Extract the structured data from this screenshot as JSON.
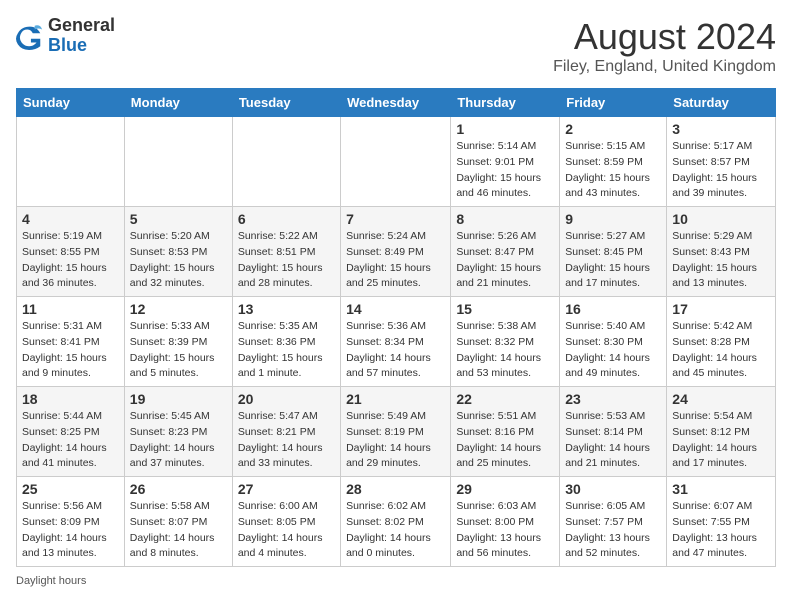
{
  "header": {
    "logo_general": "General",
    "logo_blue": "Blue",
    "month_title": "August 2024",
    "location": "Filey, England, United Kingdom"
  },
  "days_of_week": [
    "Sunday",
    "Monday",
    "Tuesday",
    "Wednesday",
    "Thursday",
    "Friday",
    "Saturday"
  ],
  "weeks": [
    [
      {
        "day": "",
        "info": ""
      },
      {
        "day": "",
        "info": ""
      },
      {
        "day": "",
        "info": ""
      },
      {
        "day": "",
        "info": ""
      },
      {
        "day": "1",
        "info": "Sunrise: 5:14 AM\nSunset: 9:01 PM\nDaylight: 15 hours and 46 minutes."
      },
      {
        "day": "2",
        "info": "Sunrise: 5:15 AM\nSunset: 8:59 PM\nDaylight: 15 hours and 43 minutes."
      },
      {
        "day": "3",
        "info": "Sunrise: 5:17 AM\nSunset: 8:57 PM\nDaylight: 15 hours and 39 minutes."
      }
    ],
    [
      {
        "day": "4",
        "info": "Sunrise: 5:19 AM\nSunset: 8:55 PM\nDaylight: 15 hours and 36 minutes."
      },
      {
        "day": "5",
        "info": "Sunrise: 5:20 AM\nSunset: 8:53 PM\nDaylight: 15 hours and 32 minutes."
      },
      {
        "day": "6",
        "info": "Sunrise: 5:22 AM\nSunset: 8:51 PM\nDaylight: 15 hours and 28 minutes."
      },
      {
        "day": "7",
        "info": "Sunrise: 5:24 AM\nSunset: 8:49 PM\nDaylight: 15 hours and 25 minutes."
      },
      {
        "day": "8",
        "info": "Sunrise: 5:26 AM\nSunset: 8:47 PM\nDaylight: 15 hours and 21 minutes."
      },
      {
        "day": "9",
        "info": "Sunrise: 5:27 AM\nSunset: 8:45 PM\nDaylight: 15 hours and 17 minutes."
      },
      {
        "day": "10",
        "info": "Sunrise: 5:29 AM\nSunset: 8:43 PM\nDaylight: 15 hours and 13 minutes."
      }
    ],
    [
      {
        "day": "11",
        "info": "Sunrise: 5:31 AM\nSunset: 8:41 PM\nDaylight: 15 hours and 9 minutes."
      },
      {
        "day": "12",
        "info": "Sunrise: 5:33 AM\nSunset: 8:39 PM\nDaylight: 15 hours and 5 minutes."
      },
      {
        "day": "13",
        "info": "Sunrise: 5:35 AM\nSunset: 8:36 PM\nDaylight: 15 hours and 1 minute."
      },
      {
        "day": "14",
        "info": "Sunrise: 5:36 AM\nSunset: 8:34 PM\nDaylight: 14 hours and 57 minutes."
      },
      {
        "day": "15",
        "info": "Sunrise: 5:38 AM\nSunset: 8:32 PM\nDaylight: 14 hours and 53 minutes."
      },
      {
        "day": "16",
        "info": "Sunrise: 5:40 AM\nSunset: 8:30 PM\nDaylight: 14 hours and 49 minutes."
      },
      {
        "day": "17",
        "info": "Sunrise: 5:42 AM\nSunset: 8:28 PM\nDaylight: 14 hours and 45 minutes."
      }
    ],
    [
      {
        "day": "18",
        "info": "Sunrise: 5:44 AM\nSunset: 8:25 PM\nDaylight: 14 hours and 41 minutes."
      },
      {
        "day": "19",
        "info": "Sunrise: 5:45 AM\nSunset: 8:23 PM\nDaylight: 14 hours and 37 minutes."
      },
      {
        "day": "20",
        "info": "Sunrise: 5:47 AM\nSunset: 8:21 PM\nDaylight: 14 hours and 33 minutes."
      },
      {
        "day": "21",
        "info": "Sunrise: 5:49 AM\nSunset: 8:19 PM\nDaylight: 14 hours and 29 minutes."
      },
      {
        "day": "22",
        "info": "Sunrise: 5:51 AM\nSunset: 8:16 PM\nDaylight: 14 hours and 25 minutes."
      },
      {
        "day": "23",
        "info": "Sunrise: 5:53 AM\nSunset: 8:14 PM\nDaylight: 14 hours and 21 minutes."
      },
      {
        "day": "24",
        "info": "Sunrise: 5:54 AM\nSunset: 8:12 PM\nDaylight: 14 hours and 17 minutes."
      }
    ],
    [
      {
        "day": "25",
        "info": "Sunrise: 5:56 AM\nSunset: 8:09 PM\nDaylight: 14 hours and 13 minutes."
      },
      {
        "day": "26",
        "info": "Sunrise: 5:58 AM\nSunset: 8:07 PM\nDaylight: 14 hours and 8 minutes."
      },
      {
        "day": "27",
        "info": "Sunrise: 6:00 AM\nSunset: 8:05 PM\nDaylight: 14 hours and 4 minutes."
      },
      {
        "day": "28",
        "info": "Sunrise: 6:02 AM\nSunset: 8:02 PM\nDaylight: 14 hours and 0 minutes."
      },
      {
        "day": "29",
        "info": "Sunrise: 6:03 AM\nSunset: 8:00 PM\nDaylight: 13 hours and 56 minutes."
      },
      {
        "day": "30",
        "info": "Sunrise: 6:05 AM\nSunset: 7:57 PM\nDaylight: 13 hours and 52 minutes."
      },
      {
        "day": "31",
        "info": "Sunrise: 6:07 AM\nSunset: 7:55 PM\nDaylight: 13 hours and 47 minutes."
      }
    ]
  ],
  "footer": {
    "daylight_label": "Daylight hours"
  }
}
